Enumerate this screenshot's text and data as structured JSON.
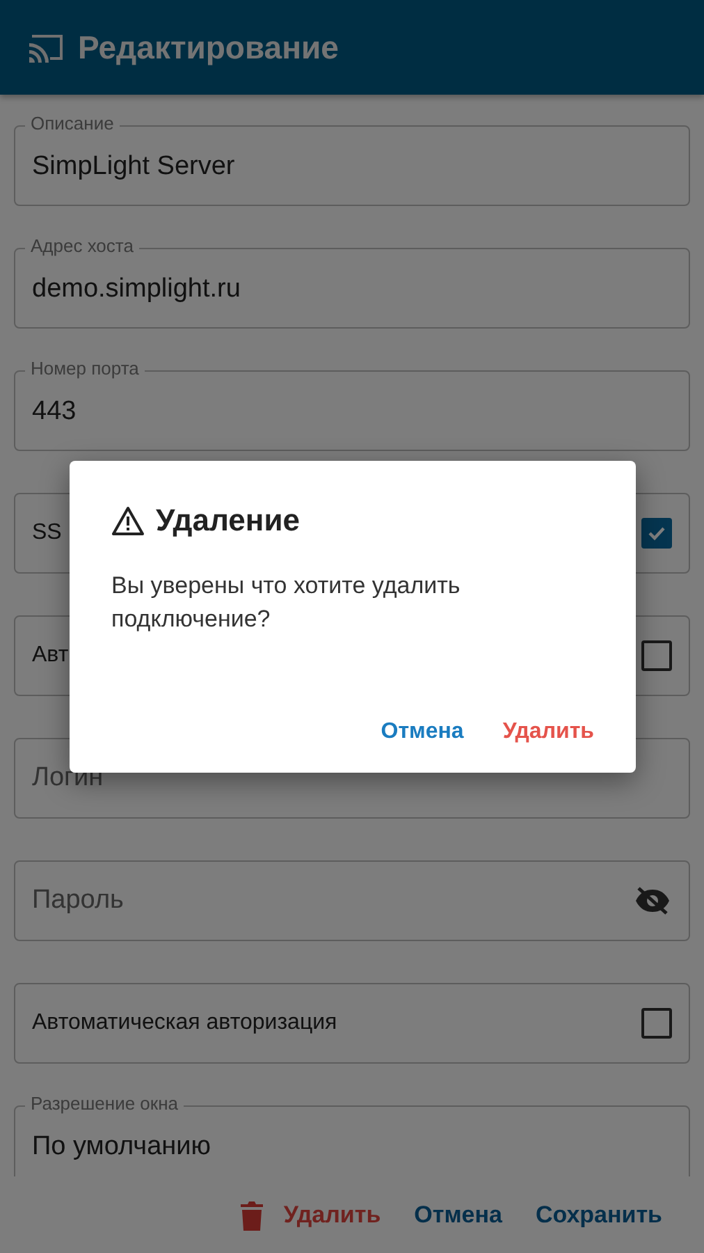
{
  "header": {
    "title": "Редактирование"
  },
  "fields": [
    {
      "kind": "outlined",
      "label": "Описание",
      "value": "SimpLight Server"
    },
    {
      "kind": "outlined",
      "label": "Адрес хоста",
      "value": "demo.simplight.ru"
    },
    {
      "kind": "outlined",
      "label": "Номер порта",
      "value": "443"
    },
    {
      "kind": "checkbox",
      "label": "SS",
      "checked": true
    },
    {
      "kind": "checkbox",
      "label": "Авт",
      "checked": false
    },
    {
      "kind": "input",
      "placeholder": "Логин"
    },
    {
      "kind": "password",
      "placeholder": "Пароль"
    },
    {
      "kind": "checkbox",
      "label": "Автоматическая авторизация",
      "checked": false
    },
    {
      "kind": "outlined",
      "label": "Разрешение окна",
      "value": "По умолчанию"
    }
  ],
  "footer": {
    "buttons": [
      {
        "kind": "danger",
        "label": "Удалить"
      },
      {
        "kind": "primary",
        "label": "Отмена"
      },
      {
        "kind": "primary",
        "label": "Сохранить"
      }
    ]
  },
  "dialog": {
    "title": "Удаление",
    "message": "Вы уверены что хотите удалить подключение?",
    "buttons": [
      {
        "kind": "primary",
        "label": "Отмена"
      },
      {
        "kind": "danger",
        "label": "Удалить"
      }
    ]
  }
}
